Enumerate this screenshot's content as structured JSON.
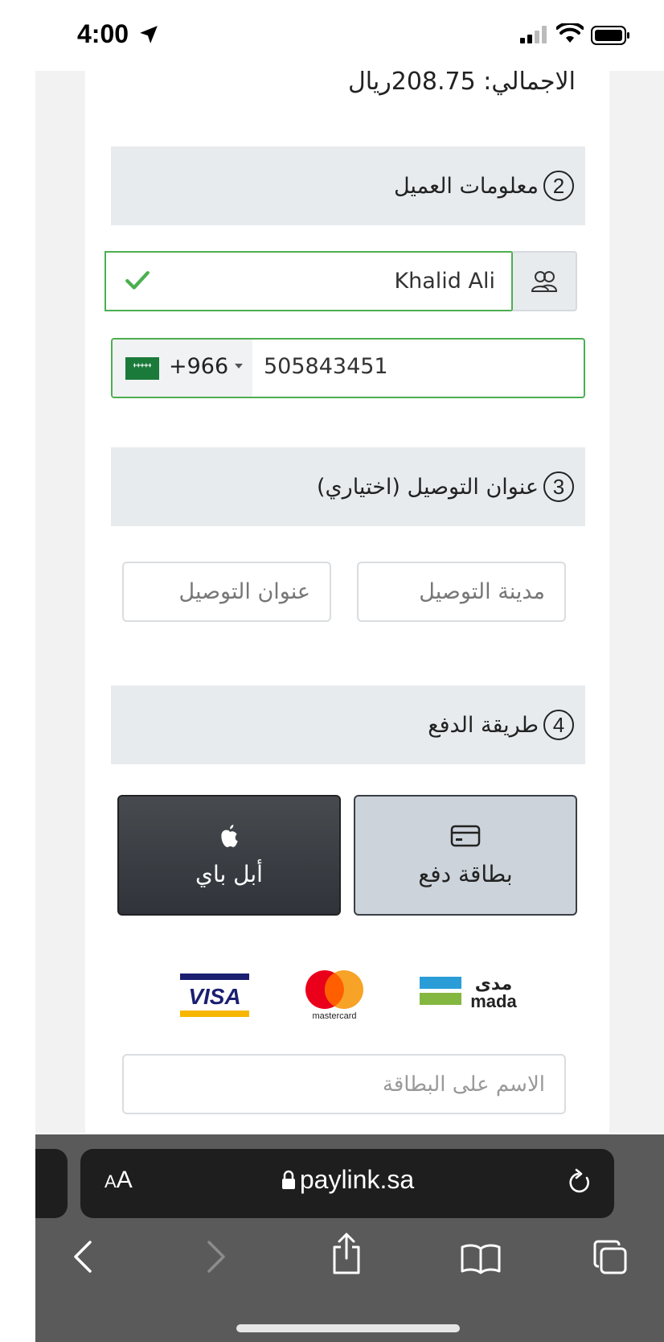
{
  "status_bar": {
    "time": "4:00"
  },
  "order": {
    "total_line": "الاجمالي: 208.75ريال"
  },
  "customer_section": {
    "number": "2",
    "title": "معلومات العميل"
  },
  "customer": {
    "name_value": "Khalid Ali",
    "dial_code": "+966",
    "phone_value": "505843451"
  },
  "delivery_section": {
    "number": "3",
    "title": "عنوان التوصيل (اختياري)"
  },
  "delivery": {
    "city_placeholder": "مدينة التوصيل",
    "address_placeholder": "عنوان التوصيل"
  },
  "payment_section": {
    "number": "4",
    "title": "طريقة الدفع"
  },
  "payment": {
    "card_label": "بطاقة دفع",
    "apple_pay_label": "أبل باي",
    "card_name_placeholder": "الاسم على البطاقة"
  },
  "logos": {
    "visa": "VISA",
    "mastercard": "mastercard",
    "mada_ar": "مدى",
    "mada_en": "mada"
  },
  "browser": {
    "aa_small": "A",
    "aa_large": "A",
    "url": "paylink.sa"
  },
  "colors": {
    "success_green": "#4caf50",
    "section_bg": "#e8ebee",
    "apple_btn": "#35393e",
    "card_btn": "#ccd3da",
    "browser_dark": "#1e1e1e"
  }
}
